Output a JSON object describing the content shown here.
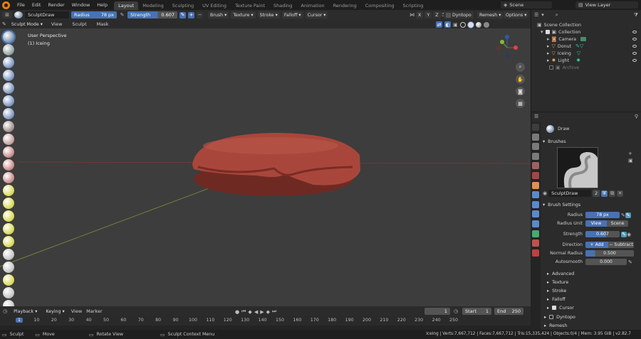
{
  "topbar": {
    "menus": [
      "File",
      "Edit",
      "Render",
      "Window",
      "Help"
    ],
    "workspaces": [
      "Layout",
      "Modeling",
      "Sculpting",
      "UV Editing",
      "Texture Paint",
      "Shading",
      "Animation",
      "Rendering",
      "Compositing",
      "Scripting"
    ],
    "active_workspace": "Layout",
    "scene": "Scene",
    "view_layer": "View Layer"
  },
  "tool_header": {
    "brush_name": "SculptDraw",
    "radius_label": "Radius",
    "radius_value": "78 px",
    "strength_label": "Strength",
    "strength_value": "0.607",
    "strength_fill": 0.607,
    "menus": [
      "Brush",
      "Texture",
      "Stroke",
      "Falloff",
      "Cursor"
    ],
    "axes": [
      "X",
      "Y",
      "Z"
    ],
    "dyntopo": "Dyntopo",
    "remesh": "Remesh",
    "options": "Options"
  },
  "viewport_header": {
    "mode": "Sculpt Mode",
    "menus": [
      "View",
      "Sculpt",
      "Mask"
    ]
  },
  "viewport": {
    "perspective": "User Perspective",
    "object": "(1) Iceing"
  },
  "timeline": {
    "menus": [
      "Playback",
      "Keying",
      "View",
      "Marker"
    ],
    "current_frame": "1",
    "start_label": "Start",
    "start": "1",
    "end_label": "End",
    "end": "250",
    "ticks": [
      "1",
      "10",
      "20",
      "30",
      "40",
      "50",
      "60",
      "70",
      "80",
      "90",
      "100",
      "110",
      "120",
      "130",
      "140",
      "150",
      "160",
      "170",
      "180",
      "190",
      "200",
      "210",
      "220",
      "230",
      "240",
      "250"
    ]
  },
  "status": {
    "items": [
      "Sculpt",
      "Move",
      "Rotate View",
      "Sculpt Context Menu"
    ],
    "stats": "Iceing | Verts:7,667,712 | Faces:7,667,712 | Tris:15,335,424 | Objects:0/4 | Mem: 3.95 GiB | v2.82.7"
  },
  "outliner": {
    "root": "Scene Collection",
    "collection": "Collection",
    "items": [
      {
        "name": "Camera",
        "color": "#e0a060"
      },
      {
        "name": "Donut",
        "color": "#e0a060"
      },
      {
        "name": "Iceing",
        "color": "#e0a060"
      },
      {
        "name": "Light",
        "color": "#e0a060"
      }
    ],
    "archive": "Archive"
  },
  "properties": {
    "brush": "Draw",
    "brushes_panel": "Brushes",
    "brush_slot": "SculptDraw",
    "brush_users": "2",
    "brush_settings_panel": "Brush Settings",
    "radius_label": "Radius",
    "radius": "78 px",
    "radius_unit_label": "Radius Unit",
    "radius_unit_options": [
      "View",
      "Scene"
    ],
    "strength_label": "Strength",
    "strength": "0.607",
    "direction_label": "Direction",
    "direction_options": [
      "Add",
      "Subtract"
    ],
    "normal_radius_label": "Normal Radius",
    "normal_radius": "0.500",
    "autosmooth_label": "Autosmooth",
    "autosmooth": "0.000",
    "subpanels": [
      "Advanced",
      "Texture",
      "Stroke",
      "Falloff",
      "Cursor"
    ],
    "dyntopo": "Dyntopo",
    "remesh": "Remesh"
  },
  "colors": {
    "accent": "#4772b3",
    "active_tab": "#3d3d3d",
    "viewport": "#3d3d3d",
    "logo": "#e87d0d"
  }
}
